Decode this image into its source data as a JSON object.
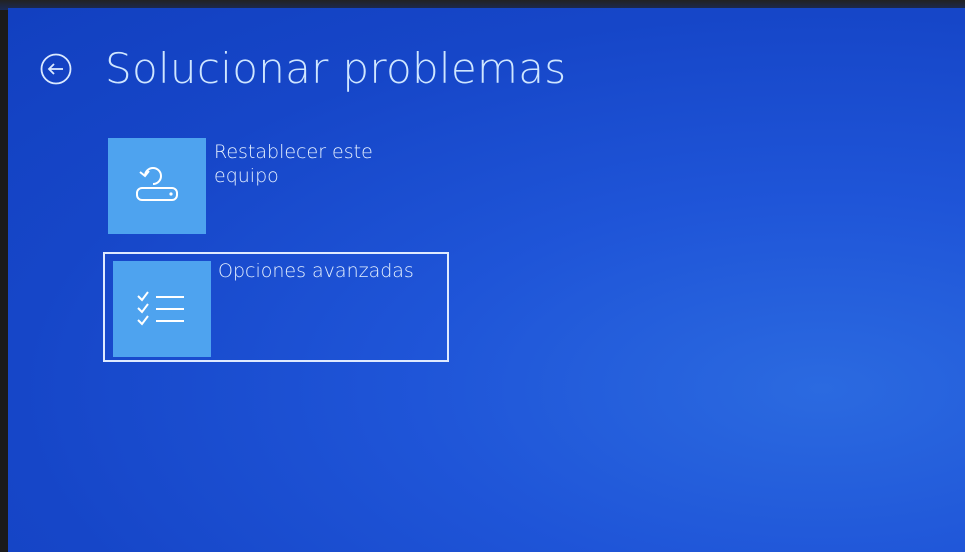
{
  "header": {
    "title": "Solucionar problemas",
    "back_icon": "back-arrow-circle-icon"
  },
  "options": [
    {
      "label": "Restablecer este equipo",
      "icon": "reset-pc-icon",
      "selected": false
    },
    {
      "label": "Opciones avanzadas",
      "icon": "checklist-icon",
      "selected": true
    }
  ],
  "colors": {
    "background": "#1a4fd0",
    "tile": "#4ea3ef",
    "title_text": "#cfe6ff",
    "label_text": "#e6f1ff",
    "selection_border": "#dfeaff"
  }
}
